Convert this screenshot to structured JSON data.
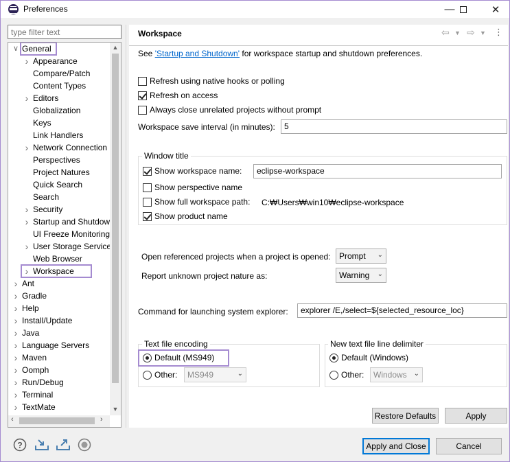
{
  "window": {
    "title": "Preferences"
  },
  "filter": {
    "placeholder": "type filter text"
  },
  "tree": {
    "items": [
      {
        "label": "General",
        "level": 0,
        "expanded": true,
        "highlighted": true
      },
      {
        "label": "Appearance",
        "level": 1,
        "expandable": true
      },
      {
        "label": "Compare/Patch",
        "level": 1
      },
      {
        "label": "Content Types",
        "level": 1
      },
      {
        "label": "Editors",
        "level": 1,
        "expandable": true
      },
      {
        "label": "Globalization",
        "level": 1
      },
      {
        "label": "Keys",
        "level": 1
      },
      {
        "label": "Link Handlers",
        "level": 1
      },
      {
        "label": "Network Connection",
        "level": 1,
        "expandable": true
      },
      {
        "label": "Perspectives",
        "level": 1
      },
      {
        "label": "Project Natures",
        "level": 1
      },
      {
        "label": "Quick Search",
        "level": 1
      },
      {
        "label": "Search",
        "level": 1
      },
      {
        "label": "Security",
        "level": 1,
        "expandable": true
      },
      {
        "label": "Startup and Shutdow",
        "level": 1,
        "expandable": true
      },
      {
        "label": "UI Freeze Monitoring",
        "level": 1
      },
      {
        "label": "User Storage Service",
        "level": 1,
        "expandable": true
      },
      {
        "label": "Web Browser",
        "level": 1
      },
      {
        "label": "Workspace",
        "level": 1,
        "expandable": true,
        "selected": true,
        "highlighted": true
      },
      {
        "label": "Ant",
        "level": 0,
        "expandable": true
      },
      {
        "label": "Gradle",
        "level": 0,
        "expandable": true
      },
      {
        "label": "Help",
        "level": 0,
        "expandable": true
      },
      {
        "label": "Install/Update",
        "level": 0,
        "expandable": true
      },
      {
        "label": "Java",
        "level": 0,
        "expandable": true
      },
      {
        "label": "Language Servers",
        "level": 0,
        "expandable": true
      },
      {
        "label": "Maven",
        "level": 0,
        "expandable": true
      },
      {
        "label": "Oomph",
        "level": 0,
        "expandable": true
      },
      {
        "label": "Run/Debug",
        "level": 0,
        "expandable": true
      },
      {
        "label": "Terminal",
        "level": 0,
        "expandable": true
      },
      {
        "label": "TextMate",
        "level": 0,
        "expandable": true
      }
    ]
  },
  "page": {
    "title": "Workspace",
    "see_prefix": "See ",
    "see_link": "'Startup and Shutdown'",
    "see_suffix": " for workspace startup and shutdown preferences.",
    "checks": [
      {
        "label": "Refresh using native hooks or polling",
        "checked": false
      },
      {
        "label": "Refresh on access",
        "checked": true
      },
      {
        "label": "Always close unrelated projects without prompt",
        "checked": false
      }
    ],
    "save_interval_label": "Workspace save interval (in minutes):",
    "save_interval_value": "5",
    "window_title": {
      "label": "Window title",
      "show_workspace_name": "Show workspace name:",
      "workspace_name_value": "eclipse-workspace",
      "show_perspective_name": "Show perspective name",
      "show_full_path": "Show full workspace path:",
      "full_path_value": "C:₩Users₩win10₩eclipse-workspace",
      "show_product_name": "Show product name"
    },
    "open_referenced_label": "Open referenced projects when a project is opened:",
    "open_referenced_value": "Prompt",
    "report_unknown_label": "Report unknown project nature as:",
    "report_unknown_value": "Warning",
    "explorer_label": "Command for launching system explorer:",
    "explorer_value": "explorer /E,/select=${selected_resource_loc}",
    "encoding": {
      "label": "Text file encoding",
      "default_label": "Default (MS949)",
      "other_label": "Other:",
      "other_value": "MS949"
    },
    "delimiter": {
      "label": "New text file line delimiter",
      "default_label": "Default (Windows)",
      "other_label": "Other:",
      "other_value": "Windows"
    },
    "restore_defaults": "Restore Defaults",
    "apply": "Apply"
  },
  "footer": {
    "apply_close": "Apply and Close",
    "cancel": "Cancel"
  },
  "colors": {
    "highlight": "#a48ad0",
    "link": "#0066cc",
    "primary_border": "#0078d7"
  }
}
